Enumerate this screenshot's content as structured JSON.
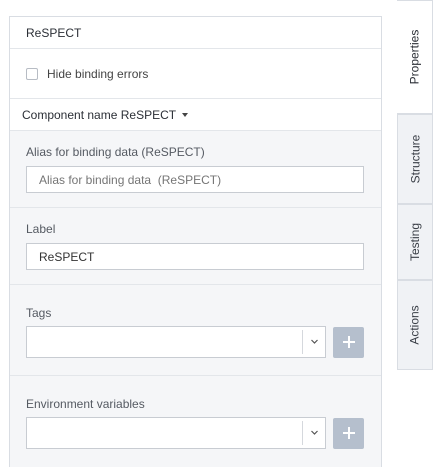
{
  "panel": {
    "title": "ReSPECT",
    "hide_binding_errors_label": "Hide binding errors",
    "hide_binding_errors_checked": false,
    "component_name_label": "Component name ReSPECT"
  },
  "fields": {
    "alias": {
      "label": "Alias for binding data (ReSPECT)",
      "placeholder": "Alias for binding data  (ReSPECT)"
    },
    "label": {
      "label": "Label",
      "value": "ReSPECT"
    },
    "tags": {
      "label": "Tags",
      "value": ""
    },
    "env": {
      "label": "Environment variables",
      "value": ""
    }
  },
  "tabs": [
    {
      "label": "Properties",
      "active": true
    },
    {
      "label": "Structure",
      "active": false
    },
    {
      "label": "Testing",
      "active": false
    },
    {
      "label": "Actions",
      "active": false
    }
  ],
  "colors": {
    "border": "#d9dde3",
    "section_bg": "#f5f6f8",
    "plus_button": "#b5bfcd",
    "tab_bg": "#f0f2f5"
  },
  "icons": {
    "dropdown": "chevron-down-icon",
    "add": "plus-icon",
    "caret": "caret-down-icon"
  }
}
